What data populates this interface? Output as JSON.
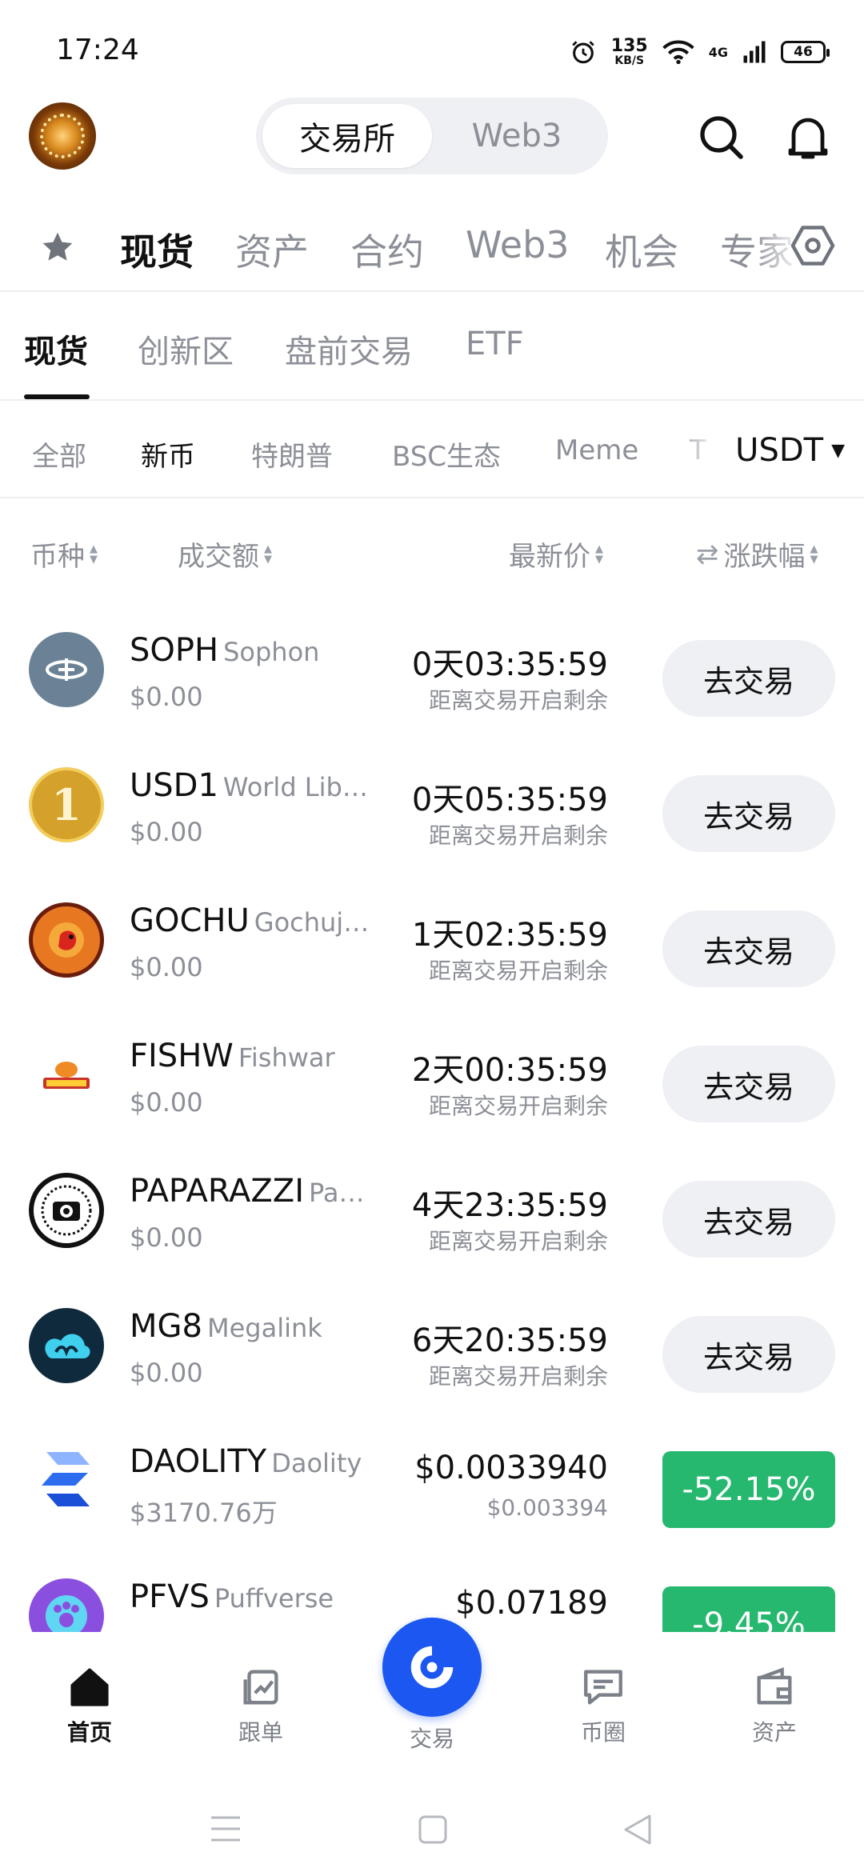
{
  "status_bar": {
    "time": "17:24",
    "speed_value": "135",
    "speed_unit": "KB/S",
    "network": "4G",
    "battery": "46"
  },
  "header": {
    "segments": [
      "交易所",
      "Web3"
    ],
    "active_segment": "交易所"
  },
  "main_tabs": [
    "现货",
    "资产",
    "合约",
    "Web3",
    "机会",
    "专家"
  ],
  "sub_tabs": [
    "现货",
    "创新区",
    "盘前交易",
    "ETF"
  ],
  "filters": [
    "全部",
    "新币",
    "特朗普",
    "BSC生态",
    "Meme",
    "T"
  ],
  "quote_currency": "USDT",
  "columns": {
    "coin": "币种",
    "volume": "成交额",
    "last_price": "最新价",
    "change": "涨跌幅"
  },
  "rows": [
    {
      "symbol": "SOPH",
      "name": "Sophon",
      "volume": "$0.00",
      "price": "0天03:35:59",
      "price_sub": "距离交易开启剩余",
      "action": "去交易",
      "icon": "soph-icon",
      "color": "#6b8296"
    },
    {
      "symbol": "USD1",
      "name": "World Lib…",
      "volume": "$0.00",
      "price": "0天05:35:59",
      "price_sub": "距离交易开启剩余",
      "action": "去交易",
      "icon": "usd1-icon",
      "color": "#d4a22a"
    },
    {
      "symbol": "GOCHU",
      "name": "Gochuj…",
      "volume": "$0.00",
      "price": "1天02:35:59",
      "price_sub": "距离交易开启剩余",
      "action": "去交易",
      "icon": "gochu-icon",
      "color": "#e87722"
    },
    {
      "symbol": "FISHW",
      "name": "Fishwar",
      "volume": "$0.00",
      "price": "2天00:35:59",
      "price_sub": "距离交易开启剩余",
      "action": "去交易",
      "icon": "fishw-icon",
      "color": "#f08a24"
    },
    {
      "symbol": "PAPARAZZI",
      "name": "Pa…",
      "volume": "$0.00",
      "price": "4天23:35:59",
      "price_sub": "距离交易开启剩余",
      "action": "去交易",
      "icon": "paparazzi-icon",
      "color": "#111111"
    },
    {
      "symbol": "MG8",
      "name": "Megalink",
      "volume": "$0.00",
      "price": "6天20:35:59",
      "price_sub": "距离交易开启剩余",
      "action": "去交易",
      "icon": "mg8-icon",
      "color": "#0f2a3d"
    },
    {
      "symbol": "DAOLITY",
      "name": "Daolity",
      "volume": "$3170.76万",
      "price": "$0.0033940",
      "price_sub": "$0.003394",
      "change": "-52.15%",
      "icon": "daolity-icon",
      "color": "#2f6df0"
    },
    {
      "symbol": "PFVS",
      "name": "Puffverse",
      "volume": "",
      "price": "$0.07189",
      "price_sub": "",
      "change": "-9.45%",
      "icon": "pfvs-icon",
      "color": "#8b4fe0"
    }
  ],
  "colors": {
    "down": "#27b86f",
    "accent": "#1b57f0"
  },
  "bottom_nav": [
    {
      "label": "首页",
      "icon": "home-icon"
    },
    {
      "label": "跟单",
      "icon": "copy-trade-icon"
    },
    {
      "label": "交易",
      "icon": "trade-icon"
    },
    {
      "label": "币圈",
      "icon": "chat-icon"
    },
    {
      "label": "资产",
      "icon": "wallet-icon"
    }
  ]
}
